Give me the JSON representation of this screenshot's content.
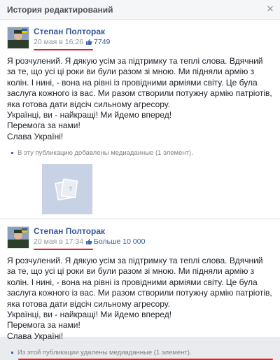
{
  "dialog": {
    "title": "История редактирований",
    "close_icon": "close-icon"
  },
  "entries": [
    {
      "author": "Степан Полторак",
      "timestamp": "20 мая в 16:26",
      "likes": "7749",
      "text": "Я розчулений. Я дякую усім за підтримку та теплі слова. Вдячний за те, що усі ці роки ви були разом зі мною. Ми підняли армію з колін. І нині, - вона на рівні із провідними арміями світу. Це була заслуга кожного із вас. Ми разом створили потужну армію патріотів, яка готова дати відсіч сильному агресору.\nУкраїнці, ви - найкращі! Ми йдемо вперед!\nПеремога за нами!\nСлава Україні!",
      "media_note": "В эту публикацию добавлены медиаданные (1 элемент)."
    },
    {
      "author": "Степан Полторак",
      "timestamp": "20 мая в 17:34",
      "likes": "Больше 10 000",
      "text": "Я розчулений. Я дякую усім за підтримку та теплі слова. Вдячний за те, що усі ці роки ви були разом зі мною. Ми підняли армію з колін. І нині, - вона на рівні із провідними арміями світу. Це була заслуга кожного із вас. Ми разом створили потужну армію патріотів, яка готова дати відсіч сильному агресору.\nУкраїнці, ви - найкращі! Ми йдемо вперед!\nПеремога за нами!\nСлава Україні!",
      "media_note": "Из этой публикации удалены медиаданные (1 элемент)."
    }
  ],
  "colors": {
    "link": "#365899",
    "highlight": "#e3212c",
    "placeholder": "#c7d2e4"
  }
}
